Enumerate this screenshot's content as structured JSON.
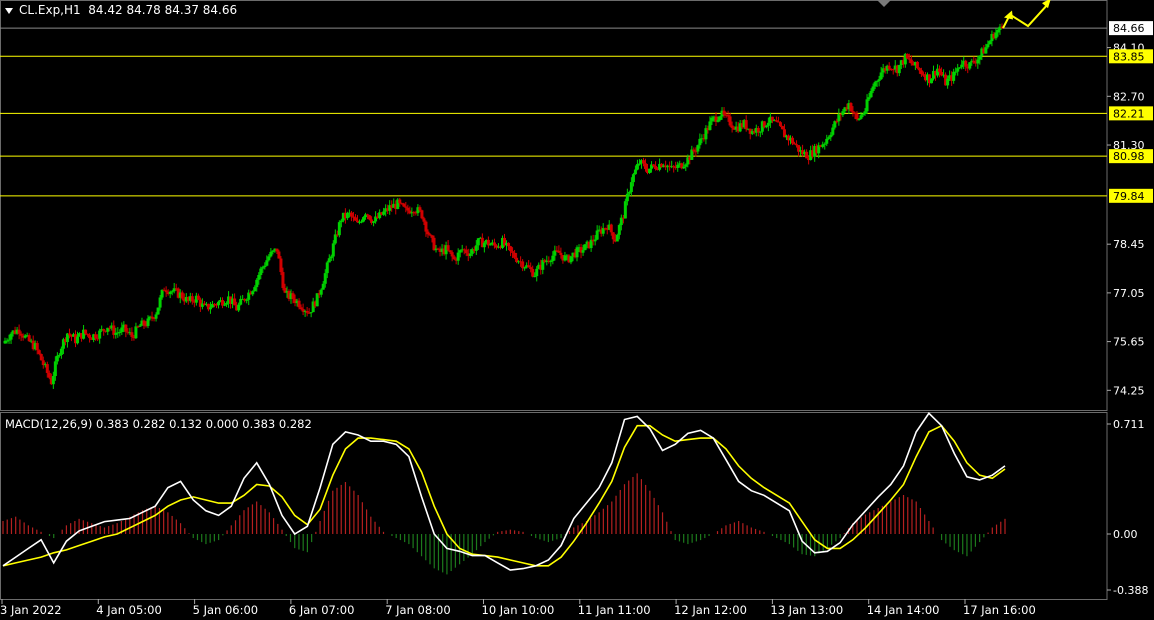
{
  "header": {
    "symbol_info": "CL.Exp,H1  84.42 84.78 84.37 84.66",
    "indicator_info": "MACD(12,26,9) 0.383 0.282 0.132 0.000 0.383 0.282"
  },
  "colors": {
    "background": "#000000",
    "bull": "#00d100",
    "bear": "#d10000",
    "level": "#ffff00",
    "macd": "#ffffff",
    "signal": "#ffff00",
    "hist_pos": "#b52020",
    "hist_neg": "#1c7a1c"
  },
  "chart_data": [
    {
      "type": "candlestick",
      "title": "CL.Exp,H1",
      "y_ticks": [
        "84.10",
        "82.70",
        "81.30",
        "78.45",
        "77.05",
        "75.65",
        "74.25"
      ],
      "ylim": [
        73.7,
        85.2
      ],
      "current_price": "84.66",
      "levels": [
        "83.85",
        "82.21",
        "80.98",
        "79.84"
      ],
      "x_ticks": [
        "3 Jan 2022",
        "4 Jan 05:00",
        "5 Jan 06:00",
        "6 Jan 07:00",
        "7 Jan 08:00",
        "10 Jan 10:00",
        "11 Jan 11:00",
        "12 Jan 12:00",
        "13 Jan 13:00",
        "14 Jan 14:00",
        "17 Jan 16:00"
      ],
      "close_path": [
        75.6,
        75.9,
        76.0,
        75.7,
        75.5,
        75.0,
        74.5,
        75.4,
        75.9,
        75.7,
        75.9,
        75.8,
        75.9,
        76.1,
        75.9,
        76.0,
        75.8,
        76.1,
        76.2,
        76.5,
        77.2,
        77.1,
        77.0,
        76.8,
        76.9,
        76.6,
        76.7,
        76.8,
        76.9,
        76.6,
        76.9,
        77.2,
        77.7,
        78.1,
        78.3,
        77.0,
        76.9,
        76.7,
        76.5,
        76.9,
        77.6,
        78.4,
        79.2,
        79.3,
        79.0,
        79.4,
        79.1,
        79.3,
        79.5,
        79.6,
        79.4,
        79.5,
        79.3,
        78.6,
        78.2,
        78.3,
        78.0,
        78.3,
        78.2,
        78.5,
        78.5,
        78.4,
        78.5,
        78.2,
        78.0,
        77.8,
        77.6,
        77.9,
        78.1,
        78.2,
        78.0,
        78.2,
        78.3,
        78.5,
        78.8,
        79.0,
        78.6,
        79.3,
        80.3,
        80.8,
        80.6,
        80.7,
        80.8,
        80.6,
        80.7,
        80.9,
        81.2,
        81.6,
        82.0,
        82.2,
        82.0,
        81.8,
        81.9,
        81.7,
        81.8,
        82.0,
        81.9,
        81.6,
        81.4,
        81.1,
        81.0,
        81.2,
        81.4,
        81.8,
        82.2,
        82.5,
        82.0,
        82.3,
        83.0,
        83.4,
        83.6,
        83.5,
        83.8,
        83.6,
        83.4,
        83.2,
        83.5,
        83.1,
        83.3,
        83.7,
        83.6,
        83.8,
        84.1,
        84.5,
        84.66
      ],
      "projection": [
        84.66,
        85.05,
        84.72,
        85.35
      ]
    },
    {
      "type": "macd",
      "title": "MACD(12,26,9)",
      "values": {
        "macd": "0.383",
        "signal": "0.282",
        "hist": "0.132"
      },
      "y_ticks": [
        "0.711",
        "0.00",
        "-0.388"
      ],
      "ylim": [
        -0.42,
        0.76
      ],
      "macd": [
        -0.22,
        -0.16,
        -0.1,
        -0.04,
        -0.2,
        -0.05,
        0.02,
        0.05,
        0.08,
        0.09,
        0.1,
        0.14,
        0.18,
        0.3,
        0.34,
        0.22,
        0.15,
        0.12,
        0.18,
        0.36,
        0.46,
        0.32,
        0.12,
        0.0,
        0.05,
        0.3,
        0.58,
        0.66,
        0.64,
        0.6,
        0.6,
        0.58,
        0.5,
        0.24,
        0.0,
        -0.1,
        -0.12,
        -0.15,
        -0.15,
        -0.2,
        -0.25,
        -0.24,
        -0.22,
        -0.18,
        -0.08,
        0.1,
        0.2,
        0.3,
        0.46,
        0.74,
        0.76,
        0.68,
        0.54,
        0.58,
        0.65,
        0.67,
        0.62,
        0.48,
        0.34,
        0.28,
        0.25,
        0.2,
        0.15,
        -0.05,
        -0.13,
        -0.12,
        -0.06,
        0.06,
        0.15,
        0.24,
        0.32,
        0.44,
        0.66,
        0.78,
        0.7,
        0.52,
        0.37,
        0.35,
        0.38,
        0.44
      ],
      "signal": [
        -0.22,
        -0.2,
        -0.18,
        -0.16,
        -0.13,
        -0.11,
        -0.08,
        -0.05,
        -0.02,
        0.0,
        0.04,
        0.08,
        0.12,
        0.18,
        0.22,
        0.24,
        0.22,
        0.2,
        0.2,
        0.25,
        0.32,
        0.31,
        0.24,
        0.12,
        0.06,
        0.16,
        0.38,
        0.55,
        0.62,
        0.62,
        0.61,
        0.6,
        0.55,
        0.4,
        0.18,
        0.0,
        -0.1,
        -0.14,
        -0.15,
        -0.16,
        -0.18,
        -0.2,
        -0.22,
        -0.22,
        -0.16,
        -0.05,
        0.07,
        0.2,
        0.34,
        0.56,
        0.7,
        0.7,
        0.64,
        0.6,
        0.61,
        0.62,
        0.62,
        0.55,
        0.44,
        0.36,
        0.3,
        0.25,
        0.2,
        0.08,
        -0.04,
        -0.1,
        -0.1,
        -0.04,
        0.04,
        0.13,
        0.22,
        0.32,
        0.5,
        0.66,
        0.7,
        0.6,
        0.46,
        0.38,
        0.36,
        0.42
      ],
      "hist": [
        0.12,
        0.16,
        0.08,
        0.02,
        -0.04,
        0.08,
        0.14,
        0.1,
        0.06,
        0.1,
        0.16,
        0.22,
        0.26,
        0.2,
        0.1,
        -0.04,
        -0.1,
        -0.06,
        0.08,
        0.22,
        0.3,
        0.2,
        0.04,
        -0.14,
        -0.18,
        0.12,
        0.4,
        0.48,
        0.36,
        0.16,
        0.02,
        -0.04,
        -0.1,
        -0.22,
        -0.34,
        -0.4,
        -0.3,
        -0.2,
        -0.08,
        0.02,
        0.04,
        0.02,
        -0.04,
        -0.08,
        -0.04,
        0.06,
        0.12,
        0.2,
        0.3,
        0.46,
        0.56,
        0.4,
        0.2,
        -0.06,
        -0.1,
        -0.06,
        0.0,
        0.08,
        0.12,
        0.06,
        0.02,
        -0.04,
        -0.1,
        -0.2,
        -0.22,
        -0.14,
        -0.04,
        0.1,
        0.18,
        0.24,
        0.3,
        0.36,
        0.3,
        0.12,
        -0.06,
        -0.16,
        -0.22,
        -0.08,
        0.06,
        0.14
      ]
    }
  ]
}
